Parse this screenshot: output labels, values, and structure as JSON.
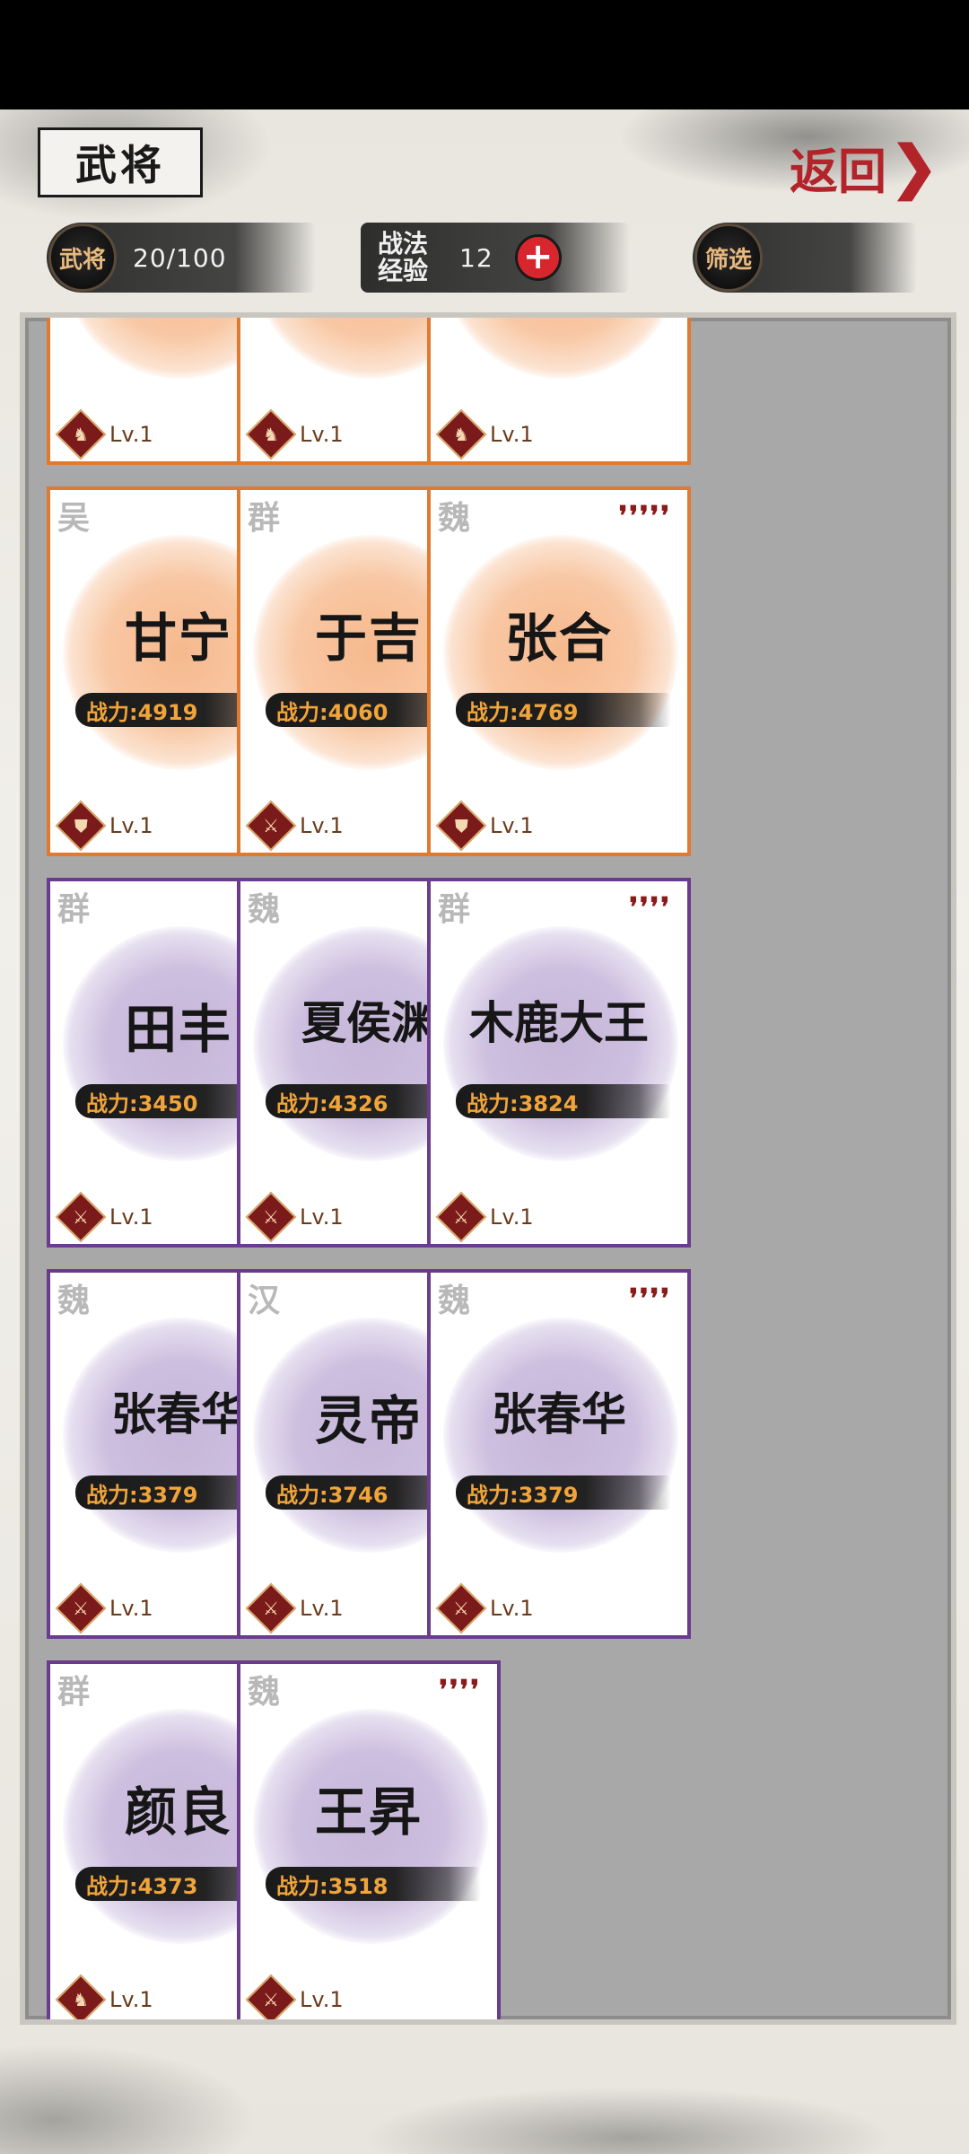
{
  "header": {
    "title": "武将",
    "back_label": "返回",
    "back_chevron": "❯"
  },
  "stats": {
    "generals_badge": "武将",
    "generals_count": "20/100",
    "exp_label": "战法经验",
    "exp_value": "12",
    "exp_add": "+",
    "filter_badge": "筛选"
  },
  "cards": [
    {
      "faction": "",
      "stars": "",
      "name": "",
      "power": "",
      "level": "Lv.1",
      "rarity": "orange",
      "role_icon": "horse-icon",
      "partial": true
    },
    {
      "faction": "",
      "stars": "",
      "name": "",
      "power": "",
      "level": "Lv.1",
      "rarity": "orange",
      "role_icon": "horse-icon",
      "partial": true
    },
    {
      "faction": "",
      "stars": "",
      "name": "",
      "power": "",
      "level": "Lv.1",
      "rarity": "orange",
      "role_icon": "horse-icon",
      "partial": true
    },
    {
      "faction": "吴",
      "stars": "❜❜❜❜❜",
      "name": "甘宁",
      "power": "战力:4919",
      "level": "Lv.1",
      "rarity": "orange",
      "role_icon": "shield-icon"
    },
    {
      "faction": "群",
      "stars": "❜❜❜❜❜",
      "name": "于吉",
      "power": "战力:4060",
      "level": "Lv.1",
      "rarity": "orange",
      "role_icon": "spear-icon"
    },
    {
      "faction": "魏",
      "stars": "❜❜❜❜❜",
      "name": "张合",
      "power": "战力:4769",
      "level": "Lv.1",
      "rarity": "orange",
      "role_icon": "shield-icon"
    },
    {
      "faction": "群",
      "stars": "❜❜❜❜",
      "name": "田丰",
      "power": "战力:3450",
      "level": "Lv.1",
      "rarity": "purple",
      "role_icon": "spear-icon"
    },
    {
      "faction": "魏",
      "stars": "❜❜❜❜",
      "name": "夏侯渊",
      "power": "战力:4326",
      "level": "Lv.1",
      "rarity": "purple",
      "role_icon": "spear-icon"
    },
    {
      "faction": "群",
      "stars": "❜❜❜❜",
      "name": "木鹿大王",
      "power": "战力:3824",
      "level": "Lv.1",
      "rarity": "purple",
      "role_icon": "spear-icon"
    },
    {
      "faction": "魏",
      "stars": "❜❜❜❜",
      "name": "张春华",
      "power": "战力:3379",
      "level": "Lv.1",
      "rarity": "purple",
      "role_icon": "spear-icon"
    },
    {
      "faction": "汉",
      "stars": "❜❜❜❜",
      "name": "灵帝",
      "power": "战力:3746",
      "level": "Lv.1",
      "rarity": "purple",
      "role_icon": "spear-icon"
    },
    {
      "faction": "魏",
      "stars": "❜❜❜❜",
      "name": "张春华",
      "power": "战力:3379",
      "level": "Lv.1",
      "rarity": "purple",
      "role_icon": "spear-icon"
    },
    {
      "faction": "群",
      "stars": "❜❜❜❜",
      "name": "颜良",
      "power": "战力:4373",
      "level": "Lv.1",
      "rarity": "purple",
      "role_icon": "horse-icon"
    },
    {
      "faction": "魏",
      "stars": "❜❜❜❜",
      "name": "王昇",
      "power": "战力:3518",
      "level": "Lv.1",
      "rarity": "purple",
      "role_icon": "spear-icon"
    }
  ]
}
